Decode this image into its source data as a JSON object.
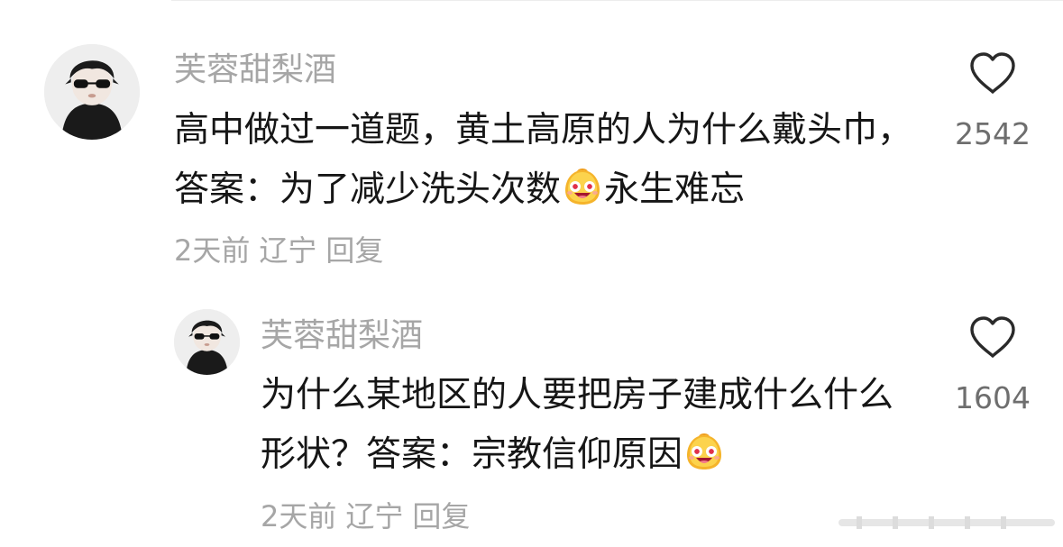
{
  "comments": [
    {
      "username": "芙蓉甜梨酒",
      "text_before": "高中做过一道题，黄土高原的人为什么戴头巾，答案：为了减少洗头次数",
      "emoji_name": "laughing-face-emoji",
      "text_after": "永生难忘",
      "time": "2天前",
      "location": "辽宁",
      "reply_label": "回复",
      "like_count": "2542",
      "like_icon": "heart-outline-icon"
    },
    {
      "username": "芙蓉甜梨酒",
      "text_before": "为什么某地区的人要把房子建成什么什么形状？答案：宗教信仰原因",
      "emoji_name": "laughing-face-emoji",
      "text_after": "",
      "time": "2天前",
      "location": "辽宁",
      "reply_label": "回复",
      "like_count": "1604",
      "like_icon": "heart-outline-icon"
    }
  ],
  "colors": {
    "text": "#161616",
    "secondary": "#a6a6a6",
    "count": "#6e6e6e"
  }
}
